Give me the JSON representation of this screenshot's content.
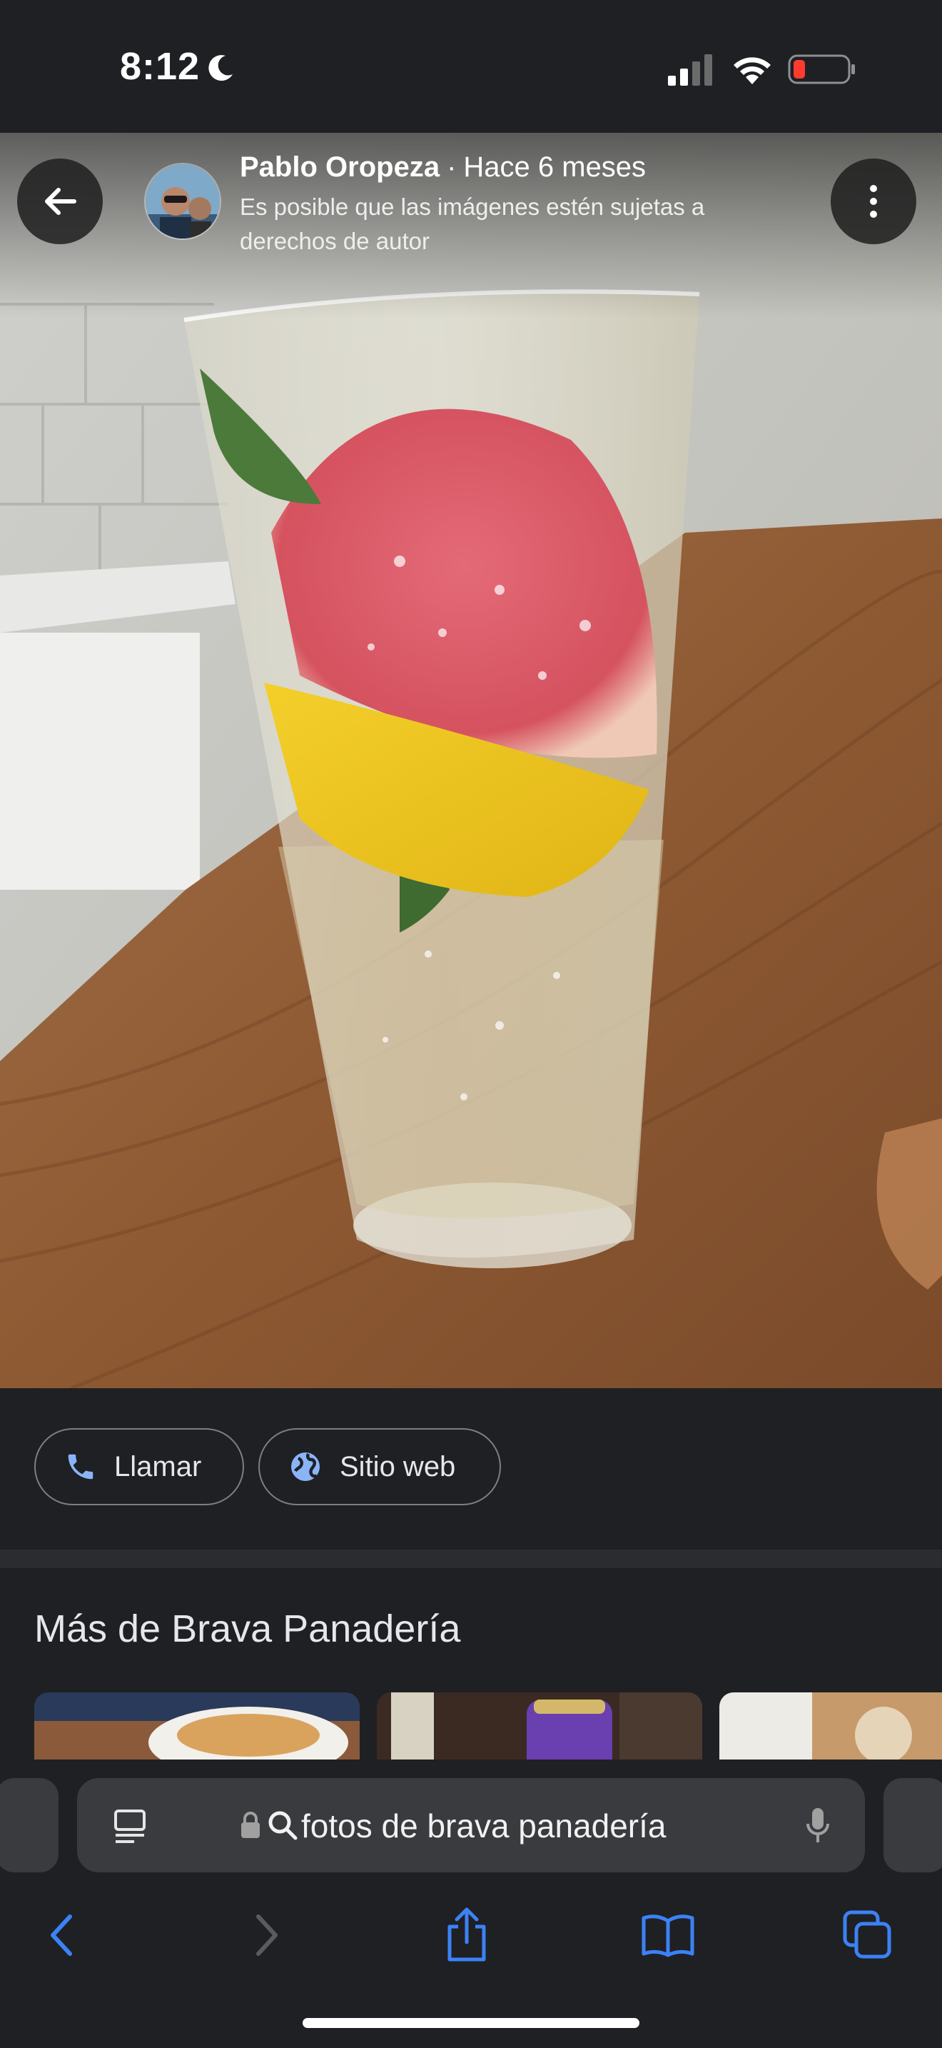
{
  "status_bar": {
    "time": "8:12"
  },
  "photo": {
    "author_name": "Pablo Oropeza",
    "separator": "·",
    "time_ago": "Hace 6 meses",
    "copyright_notice": "Es posible que las imágenes estén sujetas a derechos de autor"
  },
  "actions": {
    "call_label": "Llamar",
    "website_label": "Sitio web"
  },
  "more": {
    "title": "Más de Brava Panadería"
  },
  "safari": {
    "url_text": "fotos de brava panadería"
  },
  "colors": {
    "background": "#1f2024",
    "accent_blue": "#8ab4f8",
    "safari_blue": "#3c82f6",
    "battery_red": "#ff3b30"
  }
}
